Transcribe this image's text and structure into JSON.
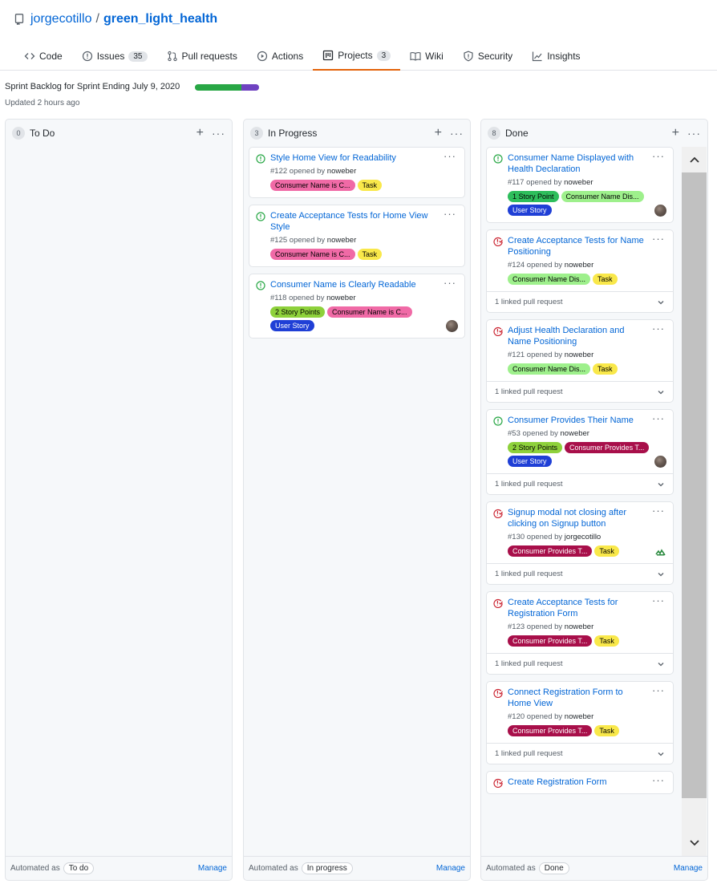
{
  "repo": {
    "owner": "jorgecotillo",
    "separator": "/",
    "name": "green_light_health"
  },
  "tabs": [
    {
      "label": "Code",
      "icon": "code-icon"
    },
    {
      "label": "Issues",
      "count": "35",
      "icon": "issue-icon"
    },
    {
      "label": "Pull requests",
      "icon": "pull-request-icon"
    },
    {
      "label": "Actions",
      "icon": "play-icon"
    },
    {
      "label": "Projects",
      "count": "3",
      "icon": "project-icon",
      "selected": true
    },
    {
      "label": "Wiki",
      "icon": "book-icon"
    },
    {
      "label": "Security",
      "icon": "shield-icon"
    },
    {
      "label": "Insights",
      "icon": "graph-icon"
    }
  ],
  "project": {
    "title": "Sprint Backlog for Sprint Ending July 9, 2020",
    "updated": "Updated 2 hours ago",
    "progress": {
      "done_fraction": 0.72,
      "in_progress_fraction": 0.28
    }
  },
  "colors": {
    "link": "#0366d6",
    "open": "#28a745",
    "closed": "#cb2431",
    "tab_accent": "#e36209"
  },
  "columns": {
    "todo": {
      "count": "0",
      "name": "To Do",
      "add": "+",
      "more": "···",
      "automated_label": "Automated as",
      "automated_value": "To do",
      "manage": "Manage",
      "cards": []
    },
    "inprogress": {
      "count": "3",
      "name": "In Progress",
      "add": "+",
      "more": "···",
      "automated_label": "Automated as",
      "automated_value": "In progress",
      "manage": "Manage",
      "cards": [
        {
          "title": "Style Home View for Readability",
          "number": "#122",
          "opened": "opened by",
          "author": "noweber",
          "status": "open",
          "labels": [
            {
              "text": "Consumer Name is C...",
              "bg": "#f06aa6",
              "fg": "#000000"
            },
            {
              "text": "Task",
              "bg": "#f9e84a",
              "fg": "#000000"
            }
          ]
        },
        {
          "title": "Create Acceptance Tests for Home View Style",
          "number": "#125",
          "opened": "opened by",
          "author": "noweber",
          "status": "open",
          "labels": [
            {
              "text": "Consumer Name is C...",
              "bg": "#f06aa6",
              "fg": "#000000"
            },
            {
              "text": "Task",
              "bg": "#f9e84a",
              "fg": "#000000"
            }
          ]
        },
        {
          "title": "Consumer Name is Clearly Readable",
          "number": "#118",
          "opened": "opened by",
          "author": "noweber",
          "status": "open",
          "labels": [
            {
              "text": "2 Story Points",
              "bg": "#8ed13b",
              "fg": "#000000"
            },
            {
              "text": "Consumer Name is C...",
              "bg": "#f06aa6",
              "fg": "#000000"
            },
            {
              "text": "User Story",
              "bg": "#1f3fd6",
              "fg": "#ffffff"
            }
          ],
          "avatar": "photo"
        }
      ]
    },
    "done": {
      "count": "8",
      "name": "Done",
      "add": "+",
      "more": "···",
      "automated_label": "Automated as",
      "automated_value": "Done",
      "manage": "Manage",
      "cards": [
        {
          "title": "Consumer Name Displayed with Health Declaration",
          "number": "#117",
          "opened": "opened by",
          "author": "noweber",
          "status": "open",
          "labels": [
            {
              "text": "1 Story Point",
              "bg": "#2ebe5c",
              "fg": "#000000"
            },
            {
              "text": "Consumer Name Dis...",
              "bg": "#9ef08c",
              "fg": "#000000"
            },
            {
              "text": "User Story",
              "bg": "#1f3fd6",
              "fg": "#ffffff"
            }
          ],
          "avatar": "photo"
        },
        {
          "title": "Create Acceptance Tests for Name Positioning",
          "number": "#124",
          "opened": "opened by",
          "author": "noweber",
          "status": "closed",
          "labels": [
            {
              "text": "Consumer Name Dis...",
              "bg": "#9ef08c",
              "fg": "#000000"
            },
            {
              "text": "Task",
              "bg": "#f9e84a",
              "fg": "#000000"
            }
          ],
          "linked": "1 linked pull request"
        },
        {
          "title": "Adjust Health Declaration and Name Positioning",
          "number": "#121",
          "opened": "opened by",
          "author": "noweber",
          "status": "closed",
          "labels": [
            {
              "text": "Consumer Name Dis...",
              "bg": "#9ef08c",
              "fg": "#000000"
            },
            {
              "text": "Task",
              "bg": "#f9e84a",
              "fg": "#000000"
            }
          ],
          "linked": "1 linked pull request"
        },
        {
          "title": "Consumer Provides Their Name",
          "number": "#53",
          "opened": "opened by",
          "author": "noweber",
          "status": "open",
          "labels": [
            {
              "text": "2 Story Points",
              "bg": "#8ed13b",
              "fg": "#000000"
            },
            {
              "text": "Consumer Provides T...",
              "bg": "#a80f4a",
              "fg": "#ffffff"
            },
            {
              "text": "User Story",
              "bg": "#1f3fd6",
              "fg": "#ffffff"
            }
          ],
          "avatar": "photo",
          "linked": "1 linked pull request"
        },
        {
          "title": "Signup modal not closing after clicking on Signup button",
          "number": "#130",
          "opened": "opened by",
          "author": "jorgecotillo",
          "status": "closed",
          "labels": [
            {
              "text": "Consumer Provides T...",
              "bg": "#a80f4a",
              "fg": "#ffffff"
            },
            {
              "text": "Task",
              "bg": "#f9e84a",
              "fg": "#000000"
            }
          ],
          "avatar": "identicon",
          "linked": "1 linked pull request"
        },
        {
          "title": "Create Acceptance Tests for Registration Form",
          "number": "#123",
          "opened": "opened by",
          "author": "noweber",
          "status": "closed",
          "labels": [
            {
              "text": "Consumer Provides T...",
              "bg": "#a80f4a",
              "fg": "#ffffff"
            },
            {
              "text": "Task",
              "bg": "#f9e84a",
              "fg": "#000000"
            }
          ],
          "linked": "1 linked pull request"
        },
        {
          "title": "Connect Registration Form to Home View",
          "number": "#120",
          "opened": "opened by",
          "author": "noweber",
          "status": "closed",
          "labels": [
            {
              "text": "Consumer Provides T...",
              "bg": "#a80f4a",
              "fg": "#ffffff"
            },
            {
              "text": "Task",
              "bg": "#f9e84a",
              "fg": "#000000"
            }
          ],
          "linked": "1 linked pull request"
        },
        {
          "title": "Create Registration Form",
          "status": "closed"
        }
      ]
    }
  }
}
